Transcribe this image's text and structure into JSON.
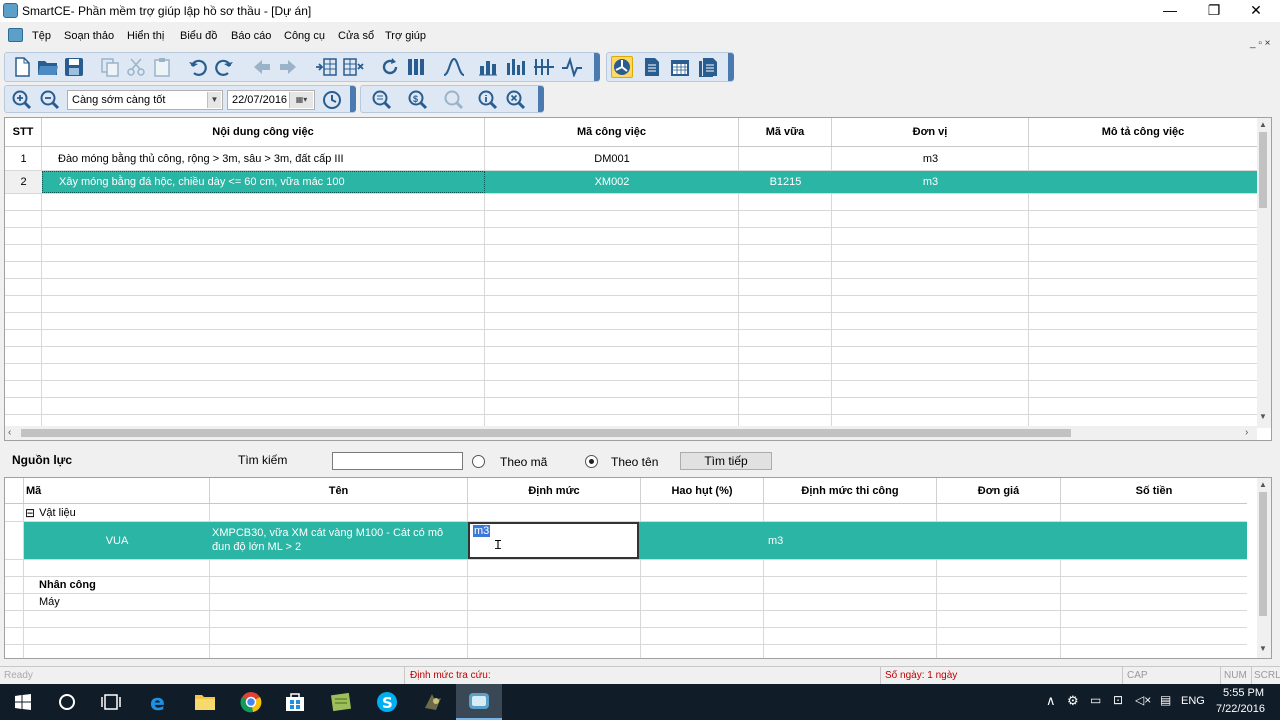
{
  "window": {
    "title": "SmartCE- Phần mềm trợ giúp lập hồ sơ thầu - [Dự án]",
    "minimize": "—",
    "restore": "❐",
    "close": "✕",
    "mdi_controls": "_ ▫ ×"
  },
  "menu": [
    "Tệp",
    "Soạn thảo",
    "Hiển thị",
    "Biểu đồ",
    "Báo cáo",
    "Công cụ",
    "Cửa sổ",
    "Trợ giúp"
  ],
  "toolbar2": {
    "schedule_mode": "Càng sớm càng tốt",
    "date": "22/07/2016"
  },
  "task_grid": {
    "columns": [
      "STT",
      "Nội dung công việc",
      "Mã công việc",
      "Mã vữa",
      "Đơn vị",
      "Mô tả công việc"
    ],
    "rows": [
      {
        "stt": "1",
        "content": "Đào móng bằng thủ công, rộng > 3m, sâu > 3m, đất cấp III",
        "code": "DM001",
        "mortar": "",
        "unit": "m3",
        "desc": ""
      },
      {
        "stt": "2",
        "content": "Xây móng bằng đá hộc, chiều dày <= 60 cm, vữa mác 100",
        "code": "XM002",
        "mortar": "B1215",
        "unit": "m3",
        "desc": ""
      }
    ],
    "selected_row": 2
  },
  "resources": {
    "label": "Nguồn lực",
    "search_label": "Tìm kiếm",
    "search_value": "",
    "radio_by_code": "Theo mã",
    "radio_by_name": "Theo tên",
    "radio_selected": "Theo tên",
    "find_next": "Tìm tiếp",
    "columns": [
      "Mã",
      "Tên",
      "Định mức",
      "Hao hụt (%)",
      "Định mức thi công",
      "Đơn giá",
      "Số tiền"
    ],
    "group_materials": "Vật liệu",
    "group_materials_toggle": "⊟",
    "material_row": {
      "code": "VUA",
      "name": "XMPCB30, vữa XM cát vàng M100 - Cát có mô đun độ lớn ML > 2",
      "norm_edit": "m3",
      "construction_norm": "m3"
    },
    "group_labor": "Nhân công",
    "group_machine": "Máy"
  },
  "status": {
    "ready": "Ready",
    "norm_lookup": "Định mức tra cứu:",
    "days": "Số ngày: 1 ngày",
    "cap": "CAP",
    "num": "NUM",
    "scrl": "SCRL"
  },
  "taskbar": {
    "lang": "ENG",
    "time": "5:55 PM",
    "date": "7/22/2016"
  },
  "colors": {
    "selection": "#2ab5a5",
    "status_text": "#c00000",
    "taskbar": "#101d29"
  }
}
